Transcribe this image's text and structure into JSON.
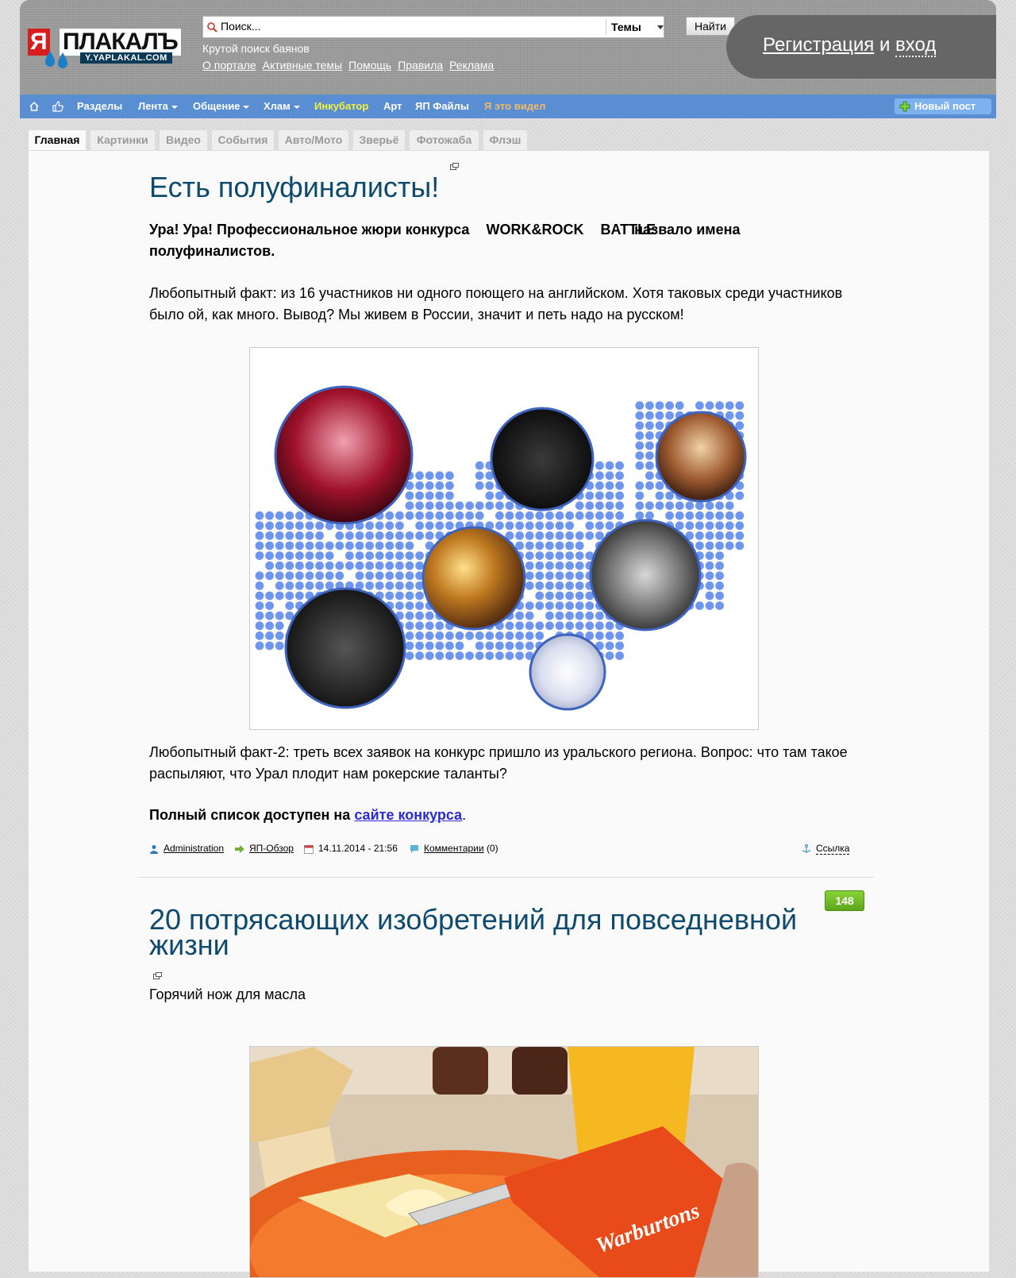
{
  "header": {
    "logo_text_ya": "ЯПЛАКАЛЪ",
    "logo_text_main": "ПЛАКАЛЪ",
    "logo_text_ya_short": "Я",
    "logo_url": "Y.YAPLAKAL.COM",
    "search_placeholder": "Поиск...",
    "topics_label": "Темы",
    "find_button": "Найти",
    "tagline": "Крутой поиск баянов",
    "links": [
      "О портале",
      "Активные темы",
      "Помощь",
      "Правила",
      "Реклама"
    ],
    "auth": {
      "register": "Регистрация",
      "and": "и",
      "login": "вход"
    }
  },
  "nav": {
    "items": [
      {
        "label": "Разделы",
        "dropdown": false,
        "color": "#ffffff"
      },
      {
        "label": "Лента",
        "dropdown": true,
        "color": "#ffffff"
      },
      {
        "label": "Общение",
        "dropdown": true,
        "color": "#ffffff"
      },
      {
        "label": "Хлам",
        "dropdown": true,
        "color": "#ffffff"
      },
      {
        "label": "Инкубатор",
        "dropdown": false,
        "color": "#f3f33a"
      },
      {
        "label": "Арт",
        "dropdown": false,
        "color": "#ffffff"
      },
      {
        "label": "ЯП Файлы",
        "dropdown": false,
        "color": "#ffffff"
      },
      {
        "label": "Я это видел",
        "dropdown": false,
        "color": "#f0b96a"
      }
    ],
    "new_post": "Новый пост",
    "icons": [
      "home-icon",
      "thumbs-up-icon"
    ]
  },
  "tabs": [
    "Главная",
    "Картинки",
    "Видео",
    "События",
    "Авто/Мото",
    "Зверьё",
    "Фотожаба",
    "Флэш"
  ],
  "posts": [
    {
      "title": "Есть полуфиналисты!",
      "lead_part1": "Ура! Ура! Профессиональное жюри конкурса",
      "lead_part2": "WORK&ROCK",
      "lead_part3": "BATTLE",
      "lead_part4": "назвало имена",
      "lead_part5": "полуфиналистов.",
      "fact1": "Любопытный факт: из 16 участников ни одного поющего на английском. Хотя таковых среди участников было ой, как много. Вывод? Мы живем в России, значит и петь надо на русском!",
      "fact2": "Любопытный факт-2: треть всех заявок на конкурс пришло из уральского региона. Вопрос: что там такое распыляют, что Урал плодит нам рокерские таланты?",
      "full_list_prefix": "Полный список доступен на",
      "full_list_link": "сайте конкурса",
      "full_list_suffix": ".",
      "meta": {
        "author": "Administration",
        "section": "ЯП-Обзор",
        "date": "14.11.2014 - 21:56",
        "comments_label": "Комментарии",
        "comments_count": "(0)",
        "link_label": "Ссылка"
      }
    },
    {
      "rating": "148",
      "title": "20 потрясающих изобретений для повседневной жизни",
      "item1": "Горячий нож для масла",
      "image_brand": "Warburtons"
    }
  ],
  "colors": {
    "nav_bg": "#5a8ed2",
    "title": "#0d4a6e",
    "link": "#2a2ad8",
    "rating": "#6cb826",
    "dot": "#6f96ee"
  }
}
